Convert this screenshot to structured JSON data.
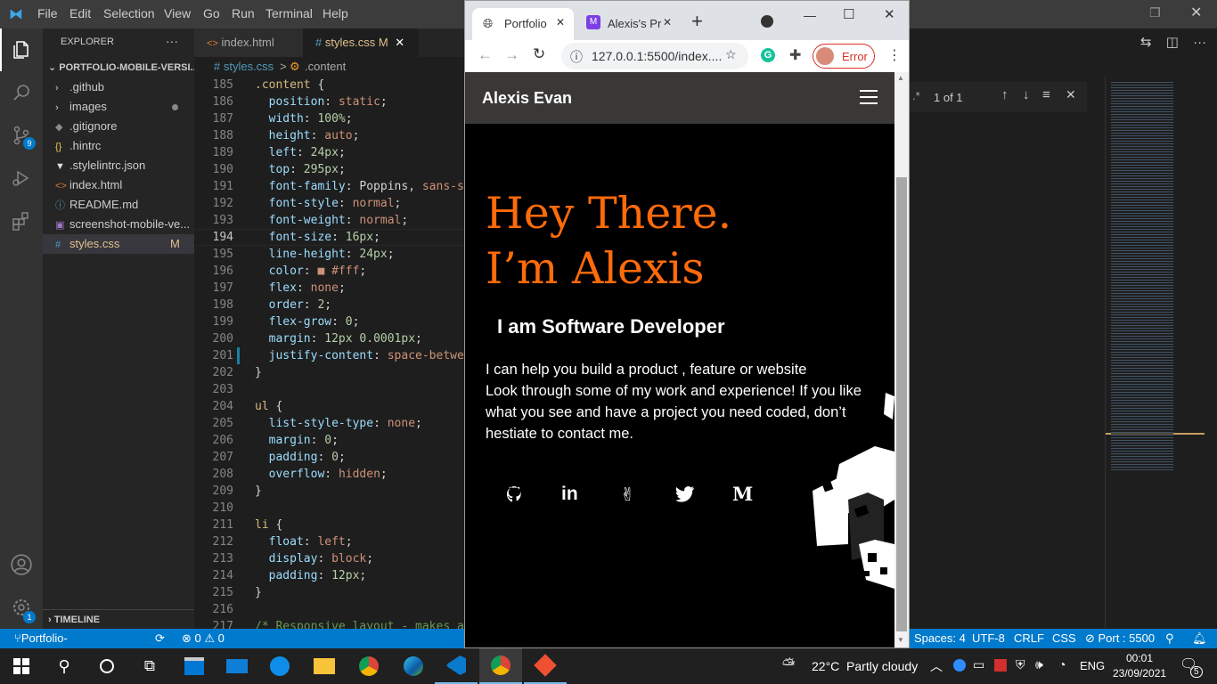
{
  "vscode": {
    "menu": [
      "File",
      "Edit",
      "Selection",
      "View",
      "Go",
      "Run",
      "Terminal",
      "Help"
    ],
    "explorer": {
      "title": "EXPLORER",
      "more": "···",
      "project": "PORTFOLIO-MOBILE-VERSI...",
      "files": [
        {
          "name": ".github",
          "icon": "›"
        },
        {
          "name": "images",
          "icon": "›"
        },
        {
          "name": ".gitignore",
          "icon": "◆"
        },
        {
          "name": ".hintrc",
          "icon": "{}"
        },
        {
          "name": ".stylelintrc.json",
          "icon": "▼"
        },
        {
          "name": "index.html",
          "icon": "<>"
        },
        {
          "name": "README.md",
          "icon": "ⓘ"
        },
        {
          "name": "screenshot-mobile-ve...",
          "icon": "▣"
        },
        {
          "name": "styles.css",
          "icon": "#",
          "badge": "M"
        }
      ],
      "timeline": "TIMELINE"
    },
    "tabs": [
      {
        "label": "index.html",
        "icon": "<>"
      },
      {
        "label": "styles.css",
        "icon": "#",
        "badge": "M",
        "close": "✕"
      }
    ],
    "breadcrumb": {
      "file": "# styles.css",
      "sep": ">",
      "symbol": ".content"
    },
    "activity_badges": {
      "scm": "9",
      "settings": "1"
    },
    "find_widget": {
      "result": "1 of 1"
    },
    "status": {
      "branch": "Portfolio-development*",
      "sync": "⟳",
      "problems": "⊗ 0 ⚠ 0",
      "spaces": "Spaces: 4",
      "encoding": "UTF-8",
      "eol": "CRLF",
      "lang": "CSS",
      "port": "⊘ Port : 5500"
    }
  },
  "code_lines": [
    {
      "n": "185",
      "t": [
        [
          ".content ",
          "sel"
        ],
        [
          "{",
          "punc"
        ]
      ]
    },
    {
      "n": "186",
      "t": [
        [
          "  position",
          "prop"
        ],
        [
          ": ",
          "punc"
        ],
        [
          "static",
          "val"
        ],
        [
          ";",
          "punc"
        ]
      ]
    },
    {
      "n": "187",
      "t": [
        [
          "  width",
          "prop"
        ],
        [
          ": ",
          "punc"
        ],
        [
          "100%",
          "num"
        ],
        [
          ";",
          "punc"
        ]
      ]
    },
    {
      "n": "188",
      "t": [
        [
          "  height",
          "prop"
        ],
        [
          ": ",
          "punc"
        ],
        [
          "auto",
          "val"
        ],
        [
          ";",
          "punc"
        ]
      ]
    },
    {
      "n": "189",
      "t": [
        [
          "  left",
          "prop"
        ],
        [
          ": ",
          "punc"
        ],
        [
          "24px",
          "num"
        ],
        [
          ";",
          "punc"
        ]
      ]
    },
    {
      "n": "190",
      "t": [
        [
          "  top",
          "prop"
        ],
        [
          ": ",
          "punc"
        ],
        [
          "295px",
          "num"
        ],
        [
          ";",
          "punc"
        ]
      ]
    },
    {
      "n": "191",
      "t": [
        [
          "  font-family",
          "prop"
        ],
        [
          ": ",
          "punc"
        ],
        [
          "Poppins, ",
          "punc"
        ],
        [
          "sans-se",
          "val"
        ]
      ]
    },
    {
      "n": "192",
      "t": [
        [
          "  font-style",
          "prop"
        ],
        [
          ": ",
          "punc"
        ],
        [
          "normal",
          "val"
        ],
        [
          ";",
          "punc"
        ]
      ]
    },
    {
      "n": "193",
      "t": [
        [
          "  font-weight",
          "prop"
        ],
        [
          ": ",
          "punc"
        ],
        [
          "normal",
          "val"
        ],
        [
          ";",
          "punc"
        ]
      ]
    },
    {
      "n": "194",
      "t": [
        [
          "  font-size",
          "prop"
        ],
        [
          ": ",
          "punc"
        ],
        [
          "16px",
          "num"
        ],
        [
          ";",
          "punc"
        ]
      ]
    },
    {
      "n": "195",
      "t": [
        [
          "  line-height",
          "prop"
        ],
        [
          ": ",
          "punc"
        ],
        [
          "24px",
          "num"
        ],
        [
          ";",
          "punc"
        ]
      ]
    },
    {
      "n": "196",
      "t": [
        [
          "  color",
          "prop"
        ],
        [
          ": ",
          "punc"
        ],
        [
          "■ #fff",
          "val"
        ],
        [
          ";",
          "punc"
        ]
      ]
    },
    {
      "n": "197",
      "t": [
        [
          "  flex",
          "prop"
        ],
        [
          ": ",
          "punc"
        ],
        [
          "none",
          "val"
        ],
        [
          ";",
          "punc"
        ]
      ]
    },
    {
      "n": "198",
      "t": [
        [
          "  order",
          "prop"
        ],
        [
          ": ",
          "punc"
        ],
        [
          "2",
          "num"
        ],
        [
          ";",
          "punc"
        ]
      ]
    },
    {
      "n": "199",
      "t": [
        [
          "  flex-grow",
          "prop"
        ],
        [
          ": ",
          "punc"
        ],
        [
          "0",
          "num"
        ],
        [
          ";",
          "punc"
        ]
      ]
    },
    {
      "n": "200",
      "t": [
        [
          "  margin",
          "prop"
        ],
        [
          ": ",
          "punc"
        ],
        [
          "12px 0.0001px",
          "num"
        ],
        [
          ";",
          "punc"
        ]
      ]
    },
    {
      "n": "201",
      "t": [
        [
          "  justify-content",
          "prop"
        ],
        [
          ": ",
          "punc"
        ],
        [
          "space-betwe",
          "val"
        ]
      ]
    },
    {
      "n": "202",
      "t": [
        [
          "}",
          "punc"
        ]
      ]
    },
    {
      "n": "203",
      "t": []
    },
    {
      "n": "204",
      "t": [
        [
          "ul ",
          "sel"
        ],
        [
          "{",
          "punc"
        ]
      ]
    },
    {
      "n": "205",
      "t": [
        [
          "  list-style-type",
          "prop"
        ],
        [
          ": ",
          "punc"
        ],
        [
          "none",
          "val"
        ],
        [
          ";",
          "punc"
        ]
      ]
    },
    {
      "n": "206",
      "t": [
        [
          "  margin",
          "prop"
        ],
        [
          ": ",
          "punc"
        ],
        [
          "0",
          "num"
        ],
        [
          ";",
          "punc"
        ]
      ]
    },
    {
      "n": "207",
      "t": [
        [
          "  padding",
          "prop"
        ],
        [
          ": ",
          "punc"
        ],
        [
          "0",
          "num"
        ],
        [
          ";",
          "punc"
        ]
      ]
    },
    {
      "n": "208",
      "t": [
        [
          "  overflow",
          "prop"
        ],
        [
          ": ",
          "punc"
        ],
        [
          "hidden",
          "val"
        ],
        [
          ";",
          "punc"
        ]
      ]
    },
    {
      "n": "209",
      "t": [
        [
          "}",
          "punc"
        ]
      ]
    },
    {
      "n": "210",
      "t": []
    },
    {
      "n": "211",
      "t": [
        [
          "li ",
          "sel"
        ],
        [
          "{",
          "punc"
        ]
      ]
    },
    {
      "n": "212",
      "t": [
        [
          "  float",
          "prop"
        ],
        [
          ": ",
          "punc"
        ],
        [
          "left",
          "val"
        ],
        [
          ";",
          "punc"
        ]
      ]
    },
    {
      "n": "213",
      "t": [
        [
          "  display",
          "prop"
        ],
        [
          ": ",
          "punc"
        ],
        [
          "block",
          "val"
        ],
        [
          ";",
          "punc"
        ]
      ]
    },
    {
      "n": "214",
      "t": [
        [
          "  padding",
          "prop"
        ],
        [
          ": ",
          "punc"
        ],
        [
          "12px",
          "num"
        ],
        [
          ";",
          "punc"
        ]
      ]
    },
    {
      "n": "215",
      "t": [
        [
          "}",
          "punc"
        ]
      ]
    },
    {
      "n": "216",
      "t": []
    },
    {
      "n": "217",
      "t": [
        [
          "/* Responsive layout - makes a",
          "cmt"
        ]
      ]
    }
  ],
  "chrome": {
    "tabs": [
      {
        "label": "Portfolio",
        "close": "✕"
      },
      {
        "label": "Alexis's Pr",
        "close": "✕"
      }
    ],
    "newtab": "+",
    "url": "127.0.0.1:5500/index....",
    "profile": "Error"
  },
  "site": {
    "brand": "Alexis Evan",
    "heading1": "Hey There.",
    "heading2": "I’m Alexis",
    "subtitle": "I am Software Developer",
    "para1": "I can help you build a product , feature or website",
    "para2": "Look through some of my work and experience! If you like what you see and have a project you need coded, don’t hestiate to contact me.",
    "social": [
      "github-icon",
      "linkedin-icon",
      "angellist-icon",
      "twitter-icon",
      "medium-icon"
    ],
    "medium": "M",
    "accent": "#ff6b0a"
  },
  "taskbar": {
    "weather": "22°C  Partly cloudy",
    "lang": "ENG",
    "time": "00:01",
    "date": "23/09/2021",
    "notif": "5"
  },
  "colors": {
    "vscode_blue": "#007acc",
    "chrome_tabbar": "#dee1e6"
  }
}
